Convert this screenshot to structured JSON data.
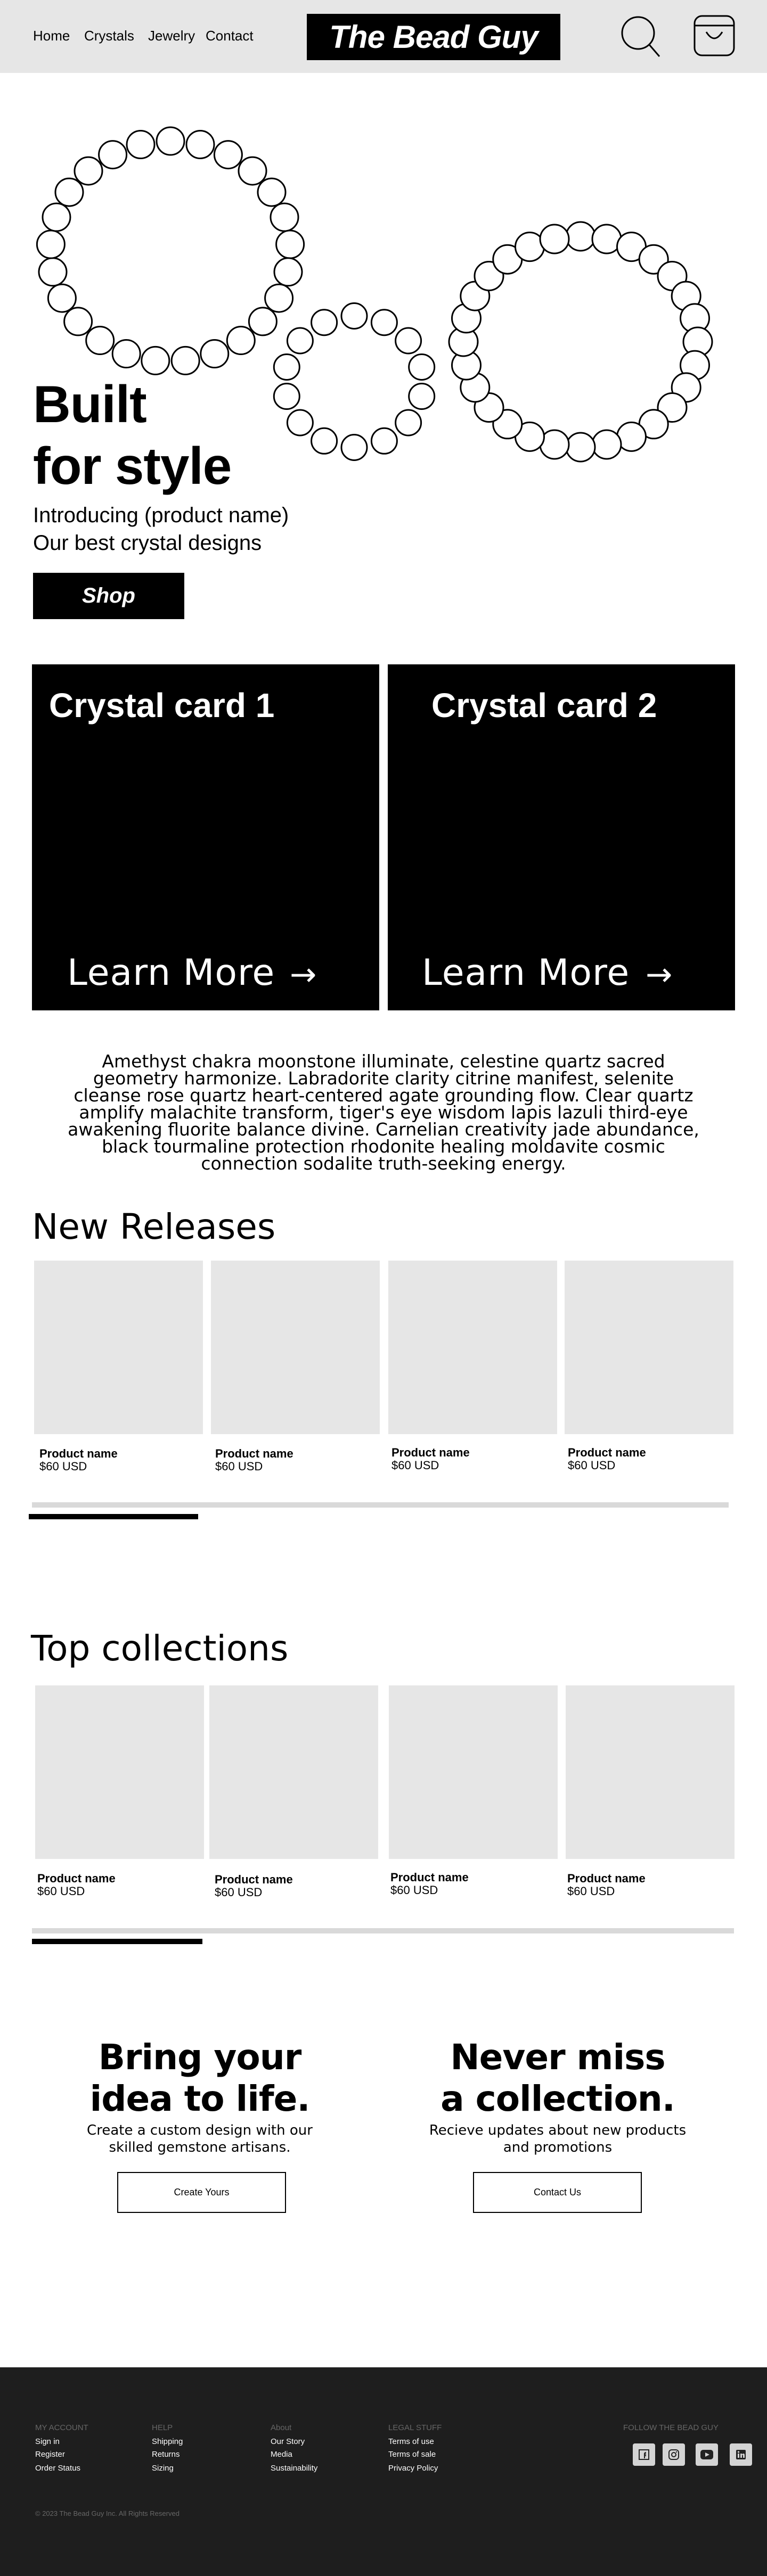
{
  "header": {
    "nav": [
      "Home",
      "Crystals",
      "Jewelry",
      "Contact"
    ],
    "logo": "The Bead Guy",
    "search_icon": "search-icon",
    "cart_icon": "shopping-bag-icon"
  },
  "hero": {
    "headline_1": "Built",
    "headline_2": "for style",
    "sub_1": "Introducing (product name)",
    "sub_2": "Our best crystal designs",
    "shop_label": "Shop"
  },
  "cards": [
    {
      "title": "Crystal card 1",
      "link": "Learn More",
      "arrow": "→"
    },
    {
      "title": "Crystal card 2",
      "link": "Learn More",
      "arrow": "→"
    }
  ],
  "paragraph": "Amethyst chakra moonstone illuminate, celestine quartz sacred geometry harmonize. Labradorite clarity citrine manifest, selenite cleanse rose quartz heart-centered agate grounding flow. Clear quartz amplify malachite transform, tiger's eye wisdom lapis lazuli third-eye awakening fluorite balance divine. Carnelian creativity jade abundance, black tourmaline protection rhodonite healing moldavite cosmic connection sodalite truth-seeking energy.",
  "new_releases": {
    "title": "New Releases",
    "products": [
      {
        "name": "Product name",
        "price": "$60 USD"
      },
      {
        "name": "Product name",
        "price": "$60 USD"
      },
      {
        "name": "Product name",
        "price": "$60 USD"
      },
      {
        "name": "Product name",
        "price": "$60 USD"
      }
    ],
    "scroll_progress": 0.24
  },
  "top_collections": {
    "title": "Top collections",
    "products": [
      {
        "name": "Product name",
        "price": "$60 USD"
      },
      {
        "name": "Product name",
        "price": "$60 USD"
      },
      {
        "name": "Product name",
        "price": "$60 USD"
      },
      {
        "name": "Product name",
        "price": "$60 USD"
      }
    ],
    "scroll_progress": 0.24
  },
  "cta": [
    {
      "h1": "Bring your",
      "h2": "idea to life.",
      "p1": "Create a custom design with our",
      "p2": "skilled gemstone artisans.",
      "button": "Create Yours"
    },
    {
      "h1": "Never miss",
      "h2": "a collection.",
      "p1": "Recieve updates about new products",
      "p2": "and promotions",
      "button": "Contact Us"
    }
  ],
  "footer": {
    "columns": [
      {
        "heading": "MY ACCOUNT",
        "links": [
          "Sign in",
          "Register",
          "Order Status"
        ]
      },
      {
        "heading": "HELP",
        "links": [
          "Shipping",
          "Returns",
          "Sizing"
        ]
      },
      {
        "heading": "About",
        "links": [
          "Our Story",
          "Media",
          "Sustainability"
        ]
      },
      {
        "heading": "LEGAL STUFF",
        "links": [
          "Terms of use",
          "Terms of sale",
          "Privacy Policy"
        ]
      }
    ],
    "follow_heading": "FOLLOW THE BEAD GUY",
    "social": [
      "facebook-icon",
      "instagram-icon",
      "youtube-icon",
      "linkedin-icon"
    ],
    "copyright": "© 2023 The Bead Guy Inc. All Rights Reserved"
  },
  "colors": {
    "header_bg": "#e6e6e6",
    "footer_bg": "#1e1e1e",
    "placeholder": "#e6e6e6"
  }
}
